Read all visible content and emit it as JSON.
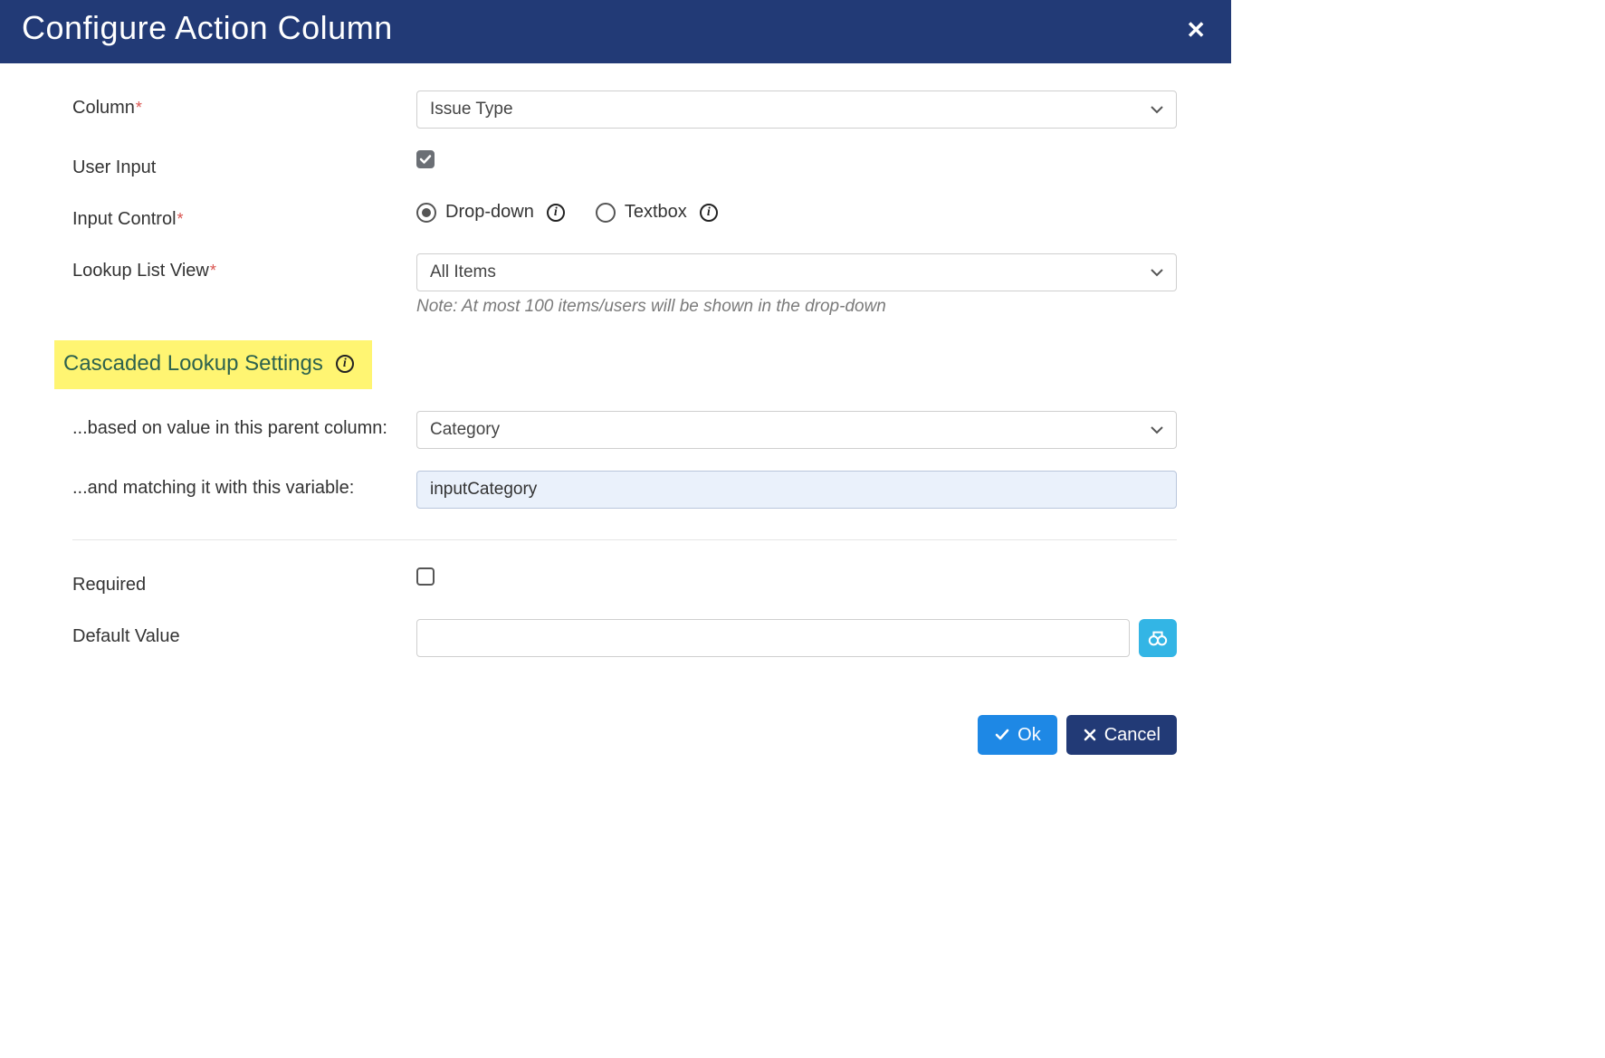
{
  "dialog": {
    "title": "Configure Action Column"
  },
  "labels": {
    "column": "Column",
    "user_input": "User Input",
    "input_control": "Input Control",
    "lookup_list_view": "Lookup List View",
    "cascaded_heading": "Cascaded Lookup Settings",
    "parent_column": "...based on value in this parent column:",
    "matching_variable": "...and matching it with this variable:",
    "required": "Required",
    "default_value": "Default Value"
  },
  "fields": {
    "column_value": "Issue Type",
    "user_input_checked": true,
    "input_control": {
      "dropdown_label": "Drop-down",
      "textbox_label": "Textbox",
      "selected": "dropdown"
    },
    "lookup_list_view_value": "All Items",
    "lookup_note": "Note: At most 100 items/users will be shown in the drop-down",
    "parent_column_value": "Category",
    "matching_variable_value": "inputCategory",
    "required_checked": false,
    "default_value": ""
  },
  "footer": {
    "ok_label": "Ok",
    "cancel_label": "Cancel"
  }
}
